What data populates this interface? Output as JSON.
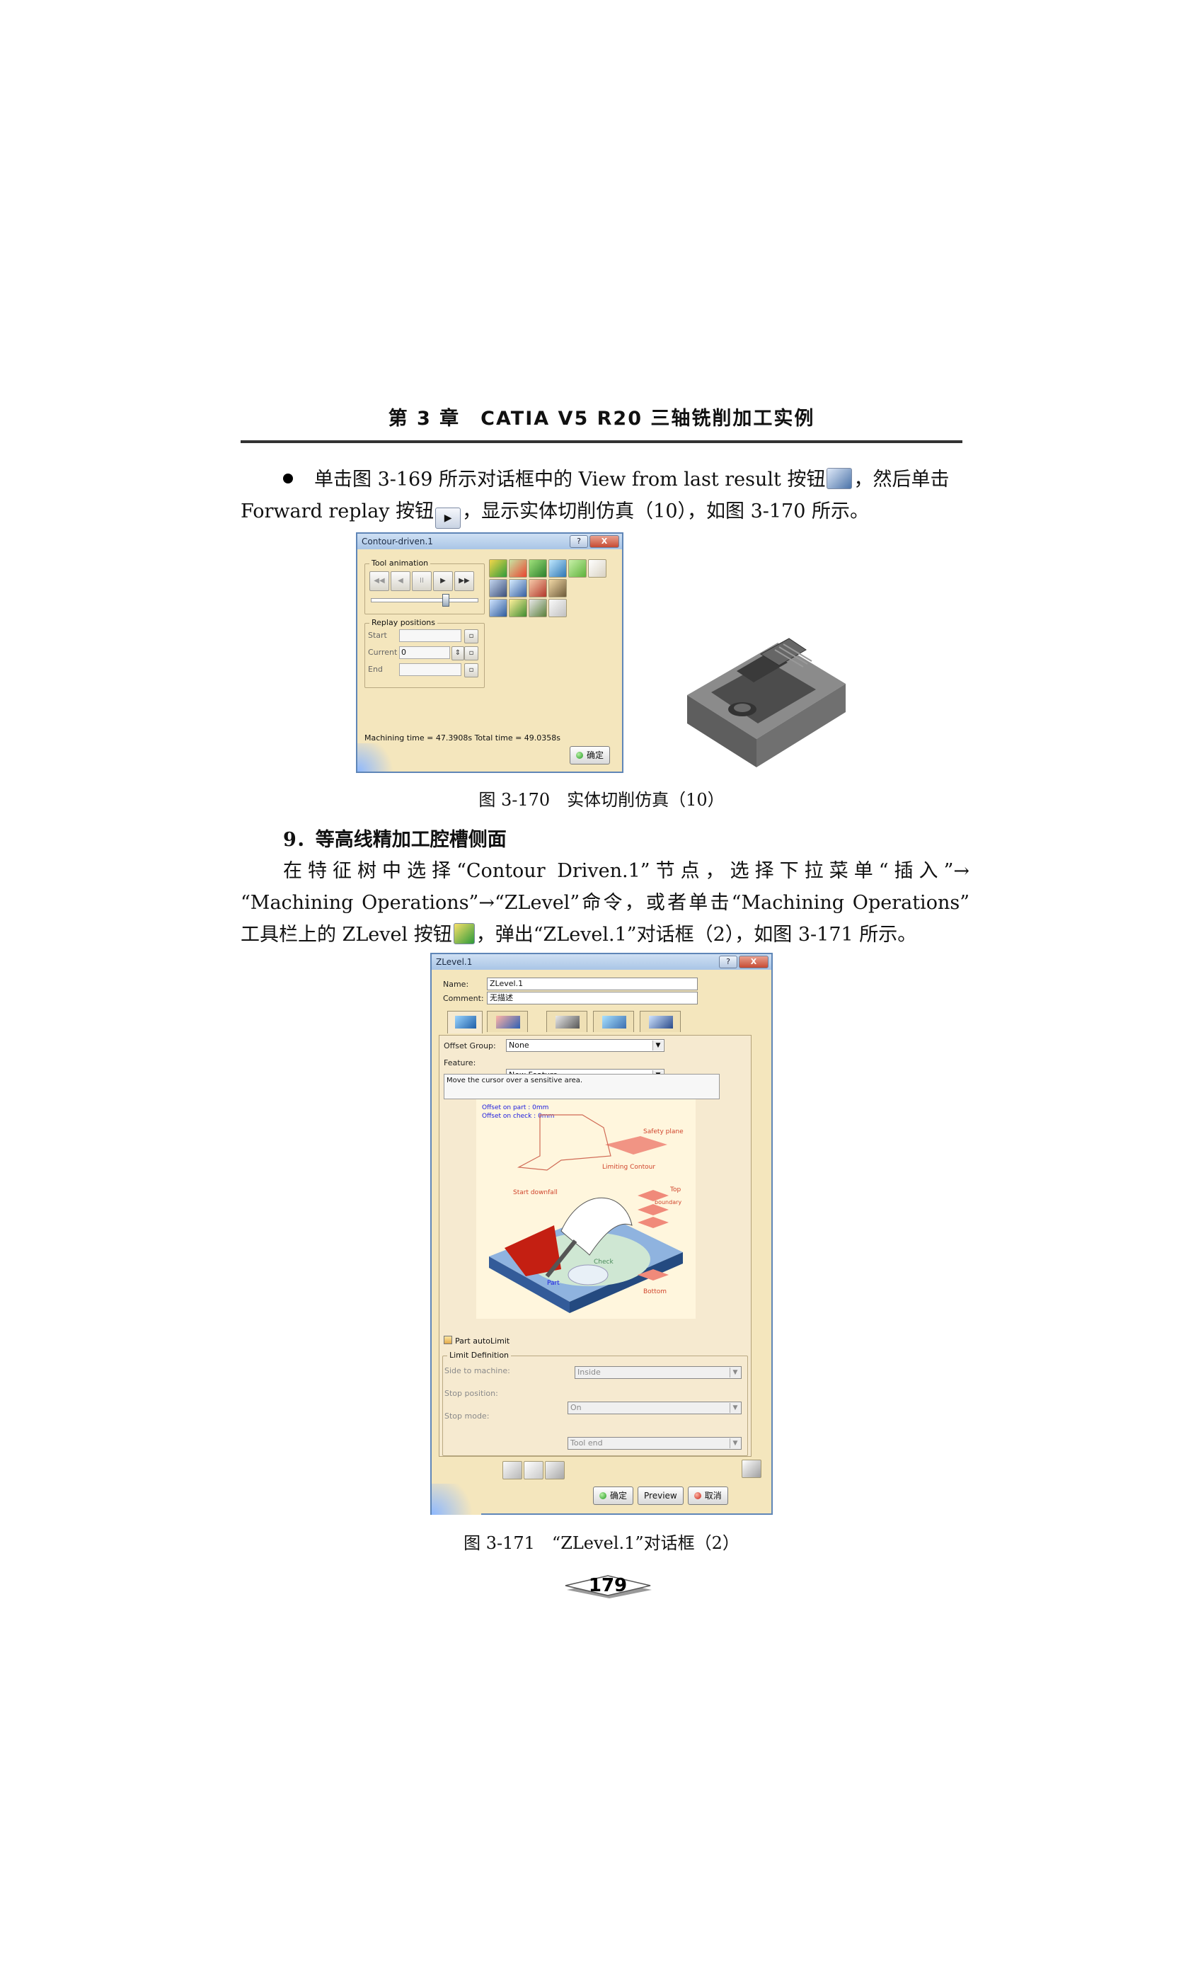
{
  "header": {
    "title": "第 3 章　CATIA V5 R20 三轴铣削加工实例"
  },
  "para1": {
    "line1_a": "单击图 3-169 所示对话框中的 View from last result 按钮",
    "line1_b": "，然后单击",
    "line2_a": "Forward replay 按钮",
    "line2_b": "，显示实体切削仿真（10），如图 3-170 所示。"
  },
  "contour_dialog": {
    "title": "Contour-driven.1",
    "help_btn": "?",
    "close_btn": "X",
    "tool_animation_label": "Tool animation",
    "playback": [
      "◀◀",
      "◀",
      "II",
      "▶",
      "▶▶"
    ],
    "replay_positions_label": "Replay positions",
    "start_label": "Start",
    "current_label": "Current",
    "current_value": "0",
    "end_label": "End",
    "machining_time": "Machining time = 47.3908s   Total time = 49.0358s",
    "ok_label": "确定"
  },
  "figure1": {
    "caption": "图 3-170　实体切削仿真（10）"
  },
  "section": {
    "title": "9．等高线精加工腔槽侧面"
  },
  "para2": {
    "line1": "在特征树中选择“Contour Driven.1”节点，选择下拉菜单“插入”→",
    "line2": "“Machining Operations”→“ZLevel”命令，或者单击“Machining Operations”",
    "line3_a": "工具栏上的 ZLevel 按钮",
    "line3_b": "，弹出“ZLevel.1”对话框（2），如图 3-171 所示。"
  },
  "zlevel_dialog": {
    "title": "ZLevel.1",
    "help_btn": "?",
    "close_btn": "X",
    "name_label": "Name:",
    "name_value": "ZLevel.1",
    "comment_label": "Comment:",
    "comment_value": "无描述",
    "offset_group_label": "Offset Group:",
    "offset_group_value": "None",
    "feature_label": "Feature:",
    "feature_value": "New Feature",
    "hint_text": "Move the cursor over a sensitive area.",
    "illustration": {
      "offset_part": "Offset on part : 0mm",
      "offset_check": "Offset on check : 0mm",
      "safety_plane": "Safety plane",
      "limiting_contour": "Limiting Contour",
      "start_downfall": "Start downfall",
      "top": "Top",
      "bottom": "Bottom",
      "check": "Check",
      "part": "Part",
      "boundary": "boundary"
    },
    "part_autolimit_label": "Part autoLimit",
    "limit_definition_label": "Limit Definition",
    "side_to_machine_label": "Side to machine:",
    "side_to_machine_value": "Inside",
    "stop_position_label": "Stop position:",
    "stop_position_value": "On",
    "stop_mode_label": "Stop mode:",
    "stop_mode_value": "Tool end",
    "ok_label": "确定",
    "preview_label": "Preview",
    "cancel_label": "取消"
  },
  "figure2": {
    "caption": "图 3-171　“ZLevel.1”对话框（2）"
  },
  "page": {
    "number": "179"
  }
}
